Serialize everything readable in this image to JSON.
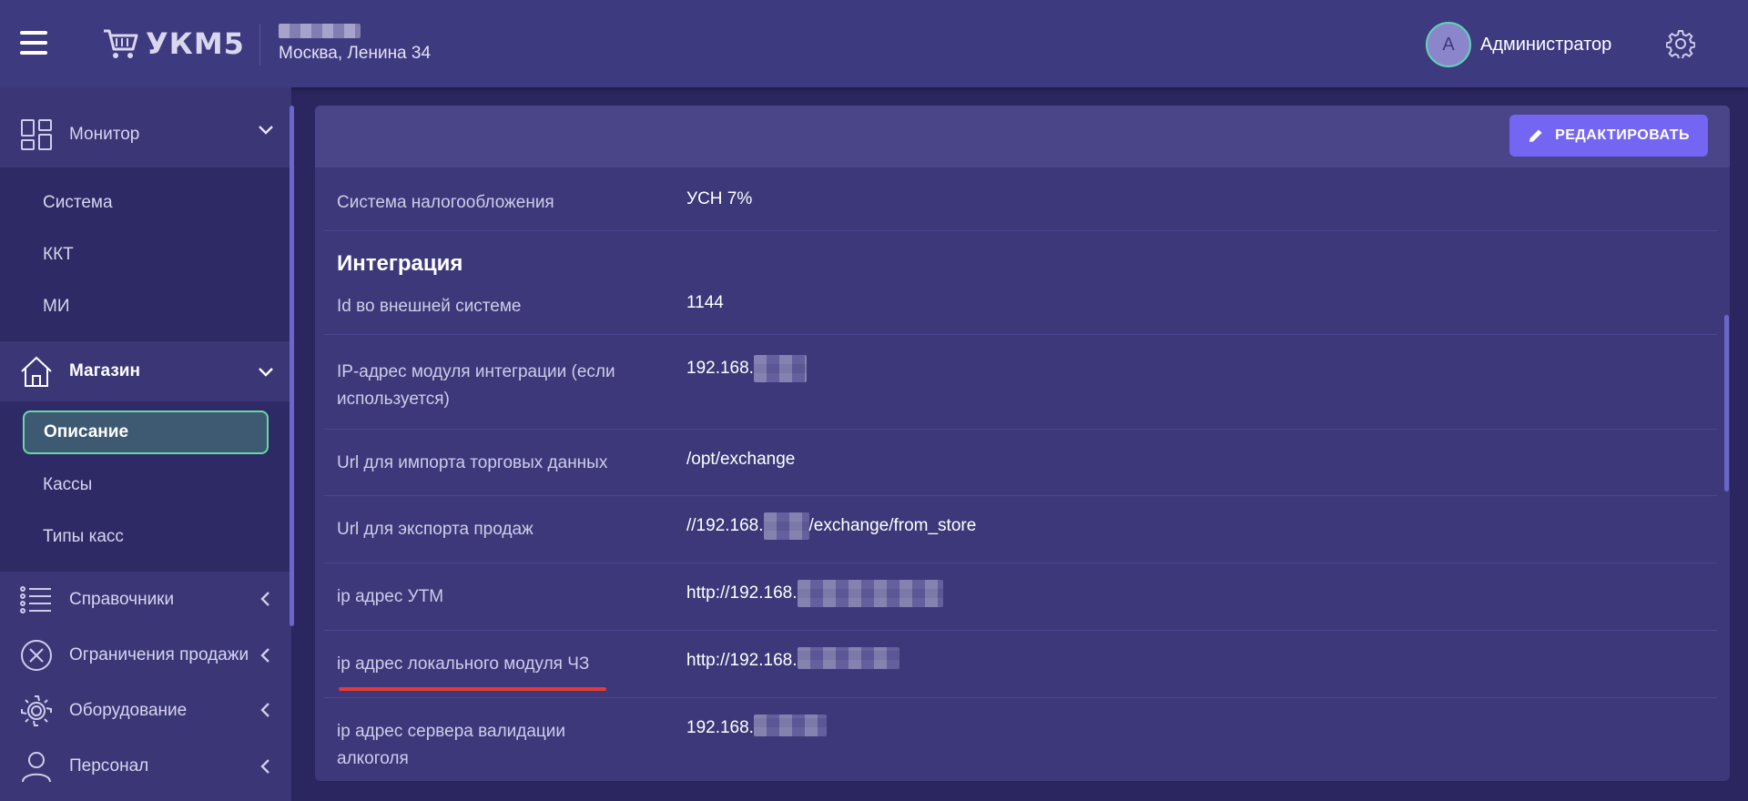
{
  "header": {
    "logo_text": "УКМ5",
    "store_address": "Москва, Ленина 34",
    "user_initial": "A",
    "user_name": "Администратор"
  },
  "sidebar": {
    "groups": [
      {
        "label": "Монитор",
        "icon": "grid-icon",
        "expanded": true,
        "items": [
          {
            "label": "Система"
          },
          {
            "label": "ККТ"
          },
          {
            "label": "МИ"
          }
        ]
      },
      {
        "label": "Магазин",
        "icon": "home-icon",
        "expanded": true,
        "items": [
          {
            "label": "Описание",
            "active": true
          },
          {
            "label": "Кассы"
          },
          {
            "label": "Типы касс"
          }
        ]
      },
      {
        "label": "Справочники",
        "icon": "list-icon",
        "expanded": false
      },
      {
        "label": "Ограничения продажи",
        "icon": "close-circle-icon",
        "expanded": false
      },
      {
        "label": "Оборудование",
        "icon": "gear-icon",
        "expanded": false
      },
      {
        "label": "Персонал",
        "icon": "user-icon",
        "expanded": false
      }
    ]
  },
  "toolbar": {
    "edit_label": "РЕДАКТИРОВАТЬ"
  },
  "fields": {
    "tax_system": {
      "label": "Система налогообложения",
      "value": "УСН 7%"
    },
    "integration_title": "Интеграция",
    "external_id": {
      "label": "Id во внешней системе",
      "value": "1144"
    },
    "integration_ip": {
      "label": "IP-адрес модуля интеграции (если используется)",
      "value_prefix": "192.168."
    },
    "import_url": {
      "label": "Url для импорта торговых данных",
      "value": "/opt/exchange"
    },
    "export_url": {
      "label": "Url для экспорта продаж",
      "value_prefix": "//192.168.",
      "value_suffix": "/exchange/from_store"
    },
    "utm_ip": {
      "label": "ip адрес УТМ",
      "value_prefix": "http://192.168."
    },
    "chz_ip": {
      "label": "ip адрес локального модуля ЧЗ",
      "value_prefix": "http://192.168."
    },
    "alcohol_ip": {
      "label": "ip адрес сервера валидации алкоголя",
      "value_prefix": "192.168."
    }
  },
  "colors": {
    "accent": "#7466f2",
    "active_border": "#69d7a8",
    "underline": "#e53935"
  }
}
